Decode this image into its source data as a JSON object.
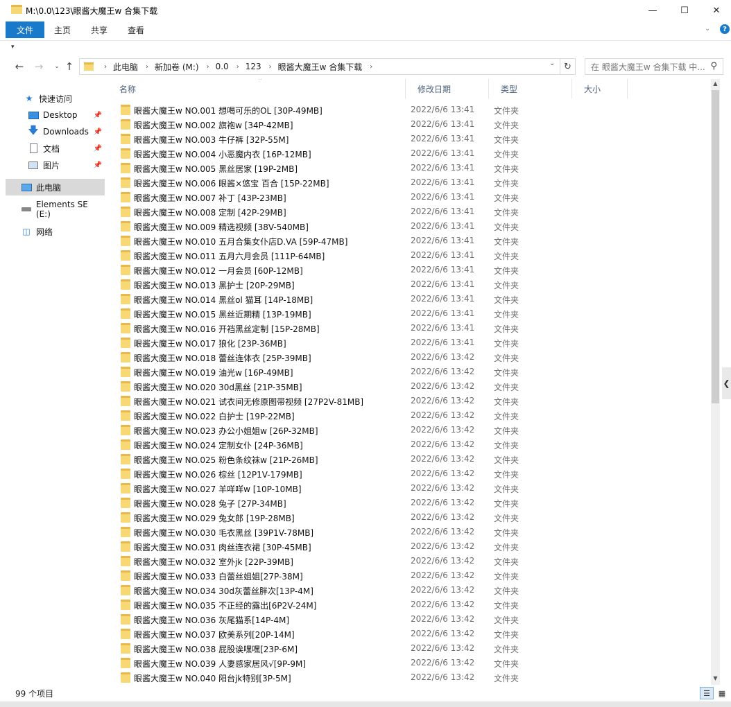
{
  "window": {
    "title": "M:\\0.0\\123\\眼酱大魔王w 合集下载",
    "min_icon": "—",
    "max_icon": "☐",
    "close_icon": "✕"
  },
  "ribbon": {
    "file_tab": "文件",
    "tabs": [
      "主页",
      "共享",
      "查看"
    ],
    "help": "?"
  },
  "address": {
    "breadcrumbs": [
      "此电脑",
      "新加卷 (M:)",
      "0.0",
      "123",
      "眼酱大魔王w 合集下载"
    ],
    "search_placeholder": "在 眼酱大魔王w 合集下载 中..."
  },
  "nav": {
    "items": [
      {
        "label": "快速访问",
        "icon": "star-icon",
        "pinned": false
      },
      {
        "label": "Desktop",
        "icon": "desktop-icon",
        "pinned": true
      },
      {
        "label": "Downloads",
        "icon": "download-icon",
        "pinned": true
      },
      {
        "label": "文档",
        "icon": "document-icon",
        "pinned": true
      },
      {
        "label": "图片",
        "icon": "picture-icon",
        "pinned": true
      },
      {
        "label": "此电脑",
        "icon": "computer-icon",
        "pinned": false,
        "selected": true
      },
      {
        "label": "Elements SE (E:)",
        "icon": "drive-icon",
        "pinned": false
      },
      {
        "label": "网络",
        "icon": "network-icon",
        "pinned": false
      }
    ]
  },
  "columns": {
    "name": "名称",
    "date": "修改日期",
    "type": "类型",
    "size": "大小"
  },
  "files": [
    {
      "name": "眼酱大魔王w NO.001 想喝可乐的OL [30P-49MB]",
      "date": "2022/6/6 13:41",
      "type": "文件夹"
    },
    {
      "name": "眼酱大魔王w NO.002 旗袍w [34P-42MB]",
      "date": "2022/6/6 13:41",
      "type": "文件夹"
    },
    {
      "name": "眼酱大魔王w NO.003 牛仔裤 [32P-55M]",
      "date": "2022/6/6 13:41",
      "type": "文件夹"
    },
    {
      "name": "眼酱大魔王w NO.004 小恶魔内衣 [16P-12MB]",
      "date": "2022/6/6 13:41",
      "type": "文件夹"
    },
    {
      "name": "眼酱大魔王w NO.005 黑丝居家 [19P-2MB]",
      "date": "2022/6/6 13:41",
      "type": "文件夹"
    },
    {
      "name": "眼酱大魔王w NO.006 眼酱×悠宝 百合 [15P-22MB]",
      "date": "2022/6/6 13:41",
      "type": "文件夹"
    },
    {
      "name": "眼酱大魔王w NO.007 补丁 [43P-23MB]",
      "date": "2022/6/6 13:41",
      "type": "文件夹"
    },
    {
      "name": "眼酱大魔王w NO.008 定制 [42P-29MB]",
      "date": "2022/6/6 13:41",
      "type": "文件夹"
    },
    {
      "name": "眼酱大魔王w NO.009 精选视频 [38V-540MB]",
      "date": "2022/6/6 13:41",
      "type": "文件夹"
    },
    {
      "name": "眼酱大魔王w NO.010 五月合集女仆店D.VA [59P-47MB]",
      "date": "2022/6/6 13:41",
      "type": "文件夹"
    },
    {
      "name": "眼酱大魔王w NO.011 五月六月会员 [111P-64MB]",
      "date": "2022/6/6 13:41",
      "type": "文件夹"
    },
    {
      "name": "眼酱大魔王w NO.012 一月会员 [60P-12MB]",
      "date": "2022/6/6 13:41",
      "type": "文件夹"
    },
    {
      "name": "眼酱大魔王w NO.013 黑护士 [20P-29MB]",
      "date": "2022/6/6 13:41",
      "type": "文件夹"
    },
    {
      "name": "眼酱大魔王w NO.014 黑丝ol 猫耳 [14P-18MB]",
      "date": "2022/6/6 13:41",
      "type": "文件夹"
    },
    {
      "name": "眼酱大魔王w NO.015 黑丝近期精 [13P-19MB]",
      "date": "2022/6/6 13:41",
      "type": "文件夹"
    },
    {
      "name": "眼酱大魔王w NO.016 开裆黑丝定制 [15P-28MB]",
      "date": "2022/6/6 13:41",
      "type": "文件夹"
    },
    {
      "name": "眼酱大魔王w NO.017 狼化 [23P-36MB]",
      "date": "2022/6/6 13:41",
      "type": "文件夹"
    },
    {
      "name": "眼酱大魔王w NO.018 蕾丝连体衣 [25P-39MB]",
      "date": "2022/6/6 13:42",
      "type": "文件夹"
    },
    {
      "name": "眼酱大魔王w NO.019 油光w [16P-49MB]",
      "date": "2022/6/6 13:42",
      "type": "文件夹"
    },
    {
      "name": "眼酱大魔王w NO.020 30d黑丝 [21P-35MB]",
      "date": "2022/6/6 13:42",
      "type": "文件夹"
    },
    {
      "name": "眼酱大魔王w NO.021 试衣间无修原图带视频 [27P2V-81MB]",
      "date": "2022/6/6 13:42",
      "type": "文件夹"
    },
    {
      "name": "眼酱大魔王w NO.022 白护士 [19P-22MB]",
      "date": "2022/6/6 13:42",
      "type": "文件夹"
    },
    {
      "name": "眼酱大魔王w NO.023 办公小姐姐w [26P-32MB]",
      "date": "2022/6/6 13:42",
      "type": "文件夹"
    },
    {
      "name": "眼酱大魔王w NO.024 定制女仆 [24P-36MB]",
      "date": "2022/6/6 13:42",
      "type": "文件夹"
    },
    {
      "name": "眼酱大魔王w NO.025 粉色条纹袜w [21P-26MB]",
      "date": "2022/6/6 13:42",
      "type": "文件夹"
    },
    {
      "name": "眼酱大魔王w NO.026 棕丝 [12P1V-179MB]",
      "date": "2022/6/6 13:42",
      "type": "文件夹"
    },
    {
      "name": "眼酱大魔王w NO.027 羊咩咩w [10P-10MB]",
      "date": "2022/6/6 13:42",
      "type": "文件夹"
    },
    {
      "name": "眼酱大魔王w NO.028 兔子 [27P-34MB]",
      "date": "2022/6/6 13:42",
      "type": "文件夹"
    },
    {
      "name": "眼酱大魔王w NO.029 兔女郎 [19P-28MB]",
      "date": "2022/6/6 13:42",
      "type": "文件夹"
    },
    {
      "name": "眼酱大魔王w NO.030 毛衣黑丝 [39P1V-78MB]",
      "date": "2022/6/6 13:42",
      "type": "文件夹"
    },
    {
      "name": "眼酱大魔王w NO.031 肉丝连衣裙 [30P-45MB]",
      "date": "2022/6/6 13:42",
      "type": "文件夹"
    },
    {
      "name": "眼酱大魔王w NO.032 室外jk [22P-39MB]",
      "date": "2022/6/6 13:42",
      "type": "文件夹"
    },
    {
      "name": "眼酱大魔王w NO.033 白蕾丝姐姐[27P-38M]",
      "date": "2022/6/6 13:42",
      "type": "文件夹"
    },
    {
      "name": "眼酱大魔王w NO.034 30d灰蕾丝胖次[13P-4M]",
      "date": "2022/6/6 13:42",
      "type": "文件夹"
    },
    {
      "name": "眼酱大魔王w NO.035 不正经的露出[6P2V-24M]",
      "date": "2022/6/6 13:42",
      "type": "文件夹"
    },
    {
      "name": "眼酱大魔王w NO.036 灰尾猫系[14P-4M]",
      "date": "2022/6/6 13:42",
      "type": "文件夹"
    },
    {
      "name": "眼酱大魔王w NO.037 欧美系列[20P-14M]",
      "date": "2022/6/6 13:42",
      "type": "文件夹"
    },
    {
      "name": "眼酱大魔王w NO.038 屁股诶嘿嘿[23P-6M]",
      "date": "2022/6/6 13:42",
      "type": "文件夹"
    },
    {
      "name": "眼酱大魔王w NO.039 人妻感家居风√[9P-9M]",
      "date": "2022/6/6 13:42",
      "type": "文件夹"
    },
    {
      "name": "眼酱大魔王w NO.040 阳台jk特别[3P-5M]",
      "date": "2022/6/6 13:42",
      "type": "文件夹"
    }
  ],
  "status": {
    "count": "99 个项目"
  },
  "colors": {
    "accent": "#1979ca",
    "folder": "#f8d775",
    "header_text": "#4c607a"
  }
}
